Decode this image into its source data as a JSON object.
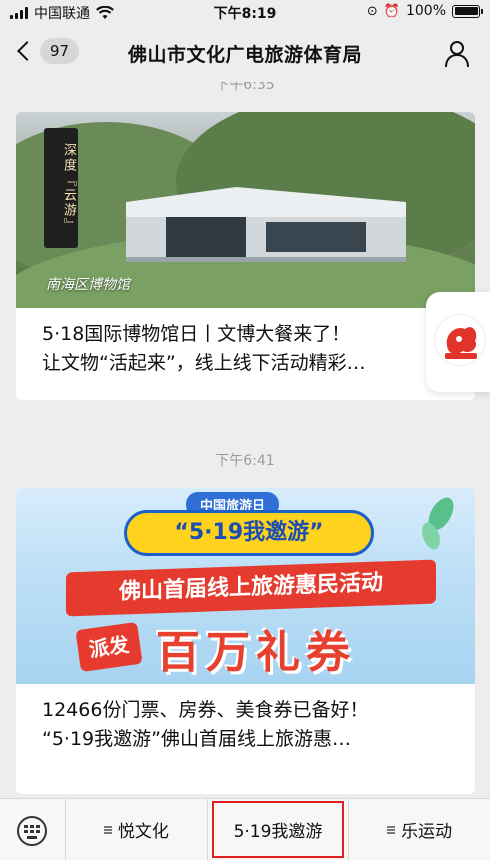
{
  "status_bar": {
    "carrier": "中国联通",
    "time": "下午8:19",
    "battery": "100%"
  },
  "nav": {
    "unread_count": "97",
    "title": "佛山市文化广电旅游体育局"
  },
  "messages": [
    {
      "time": "下午6:35",
      "image_badge": "深度『云游』",
      "image_caption": "南海区博物馆",
      "title_line1": "5·18国际博物馆日丨文博大餐来了！",
      "title_line2": "让文物“活起来”，线上线下活动精彩…"
    },
    {
      "time": "下午6:41",
      "poster_top": "中国旅游日",
      "poster_pill": "“5·19我邀游”",
      "poster_ribbon": "佛山首届线上旅游惠民活动",
      "poster_send": "派发",
      "poster_big": "百万礼券",
      "title_line1": "12466份门票、房券、美食券已备好！",
      "title_line2": "“5·19我邀游”佛山首届线上旅游惠…"
    }
  ],
  "menu": {
    "items": [
      "悦文化",
      "5·19我邀游",
      "乐运动"
    ]
  },
  "colors": {
    "background": "#ededed",
    "highlight": "#e02020"
  }
}
